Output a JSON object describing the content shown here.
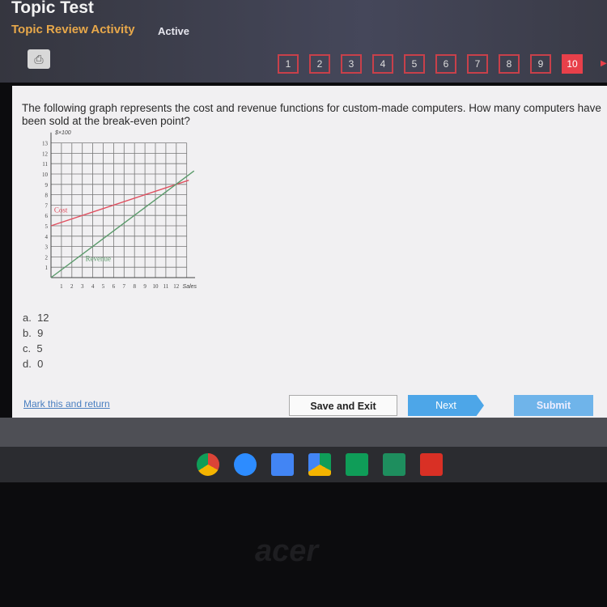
{
  "header": {
    "title": "Topic Test",
    "subtitle": "Topic Review Activity",
    "status": "Active"
  },
  "pages": [
    "1",
    "2",
    "3",
    "4",
    "5",
    "6",
    "7",
    "8",
    "9",
    "10"
  ],
  "current_page": "10",
  "question": {
    "text": "The following graph represents the cost and revenue functions for custom-made computers. How many computers have been sold at the break-even point?",
    "options": [
      {
        "letter": "a.",
        "value": "12"
      },
      {
        "letter": "b.",
        "value": "9"
      },
      {
        "letter": "c.",
        "value": "5"
      },
      {
        "letter": "d.",
        "value": "0"
      }
    ]
  },
  "footer": {
    "mark": "Mark this and return",
    "save": "Save and Exit",
    "next": "Next",
    "submit": "Submit"
  },
  "dock_icons": [
    "chrome-icon",
    "zoom-icon",
    "docs-icon",
    "drive-icon",
    "sheets-icon",
    "classroom-icon",
    "gmail-icon"
  ],
  "brand": "acer",
  "chart_data": {
    "type": "line",
    "ylabel": "$×100",
    "xlabel": "Sales",
    "xlim": [
      0,
      13
    ],
    "ylim": [
      0,
      13
    ],
    "x_ticks": [
      "1",
      "2",
      "3",
      "4",
      "5",
      "6",
      "7",
      "8",
      "9",
      "10",
      "11",
      "12"
    ],
    "y_ticks": [
      "1",
      "2",
      "3",
      "4",
      "5",
      "6",
      "7",
      "8",
      "9",
      "10",
      "11",
      "12",
      "13"
    ],
    "grid": true,
    "series": [
      {
        "name": "Cost",
        "color": "#e05060",
        "x": [
          0,
          13.2
        ],
        "y": [
          5,
          9.4
        ]
      },
      {
        "name": "Revenue",
        "color": "#5a9a6a",
        "x": [
          0,
          13.7
        ],
        "y": [
          0,
          10.3
        ]
      }
    ]
  }
}
